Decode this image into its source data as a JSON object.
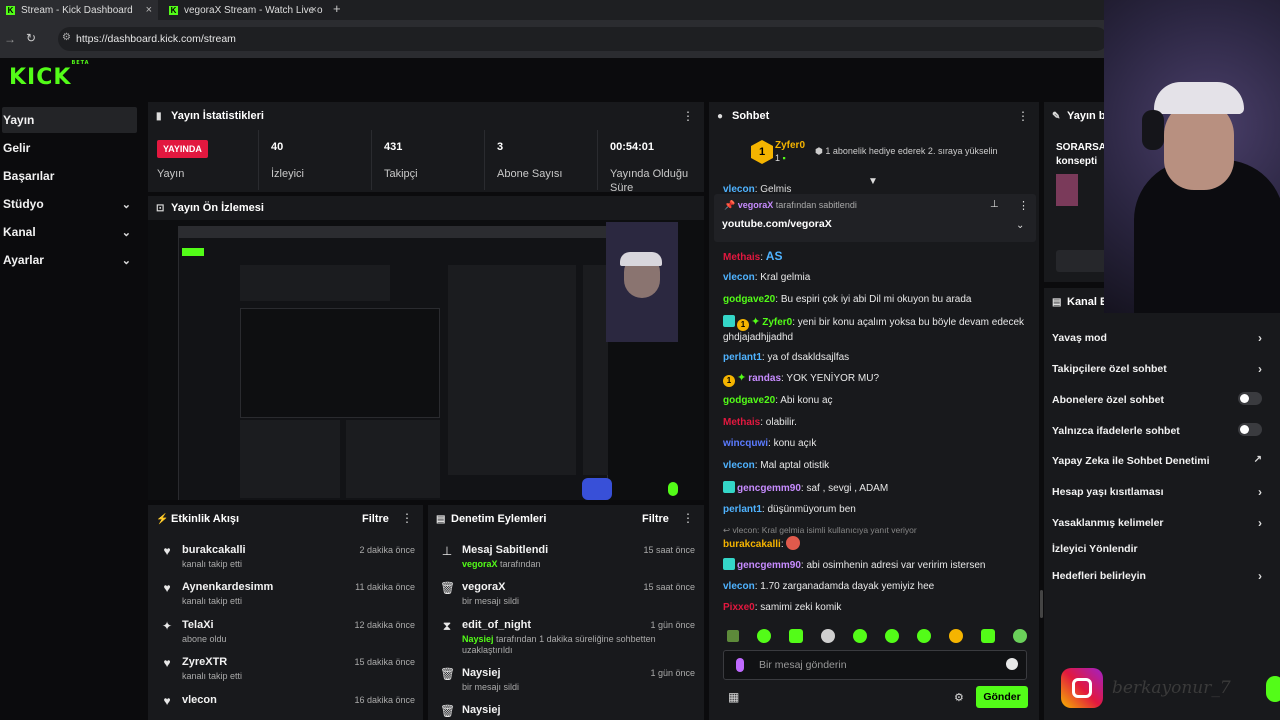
{
  "browser": {
    "tabs": [
      {
        "title": "Stream - Kick Dashboard"
      },
      {
        "title": "vegoraX Stream - Watch Live o"
      }
    ],
    "new_tab": "+",
    "url": "https://dashboard.kick.com/stream"
  },
  "logo": "KICK",
  "logo_sup": "BETA",
  "sidebar": {
    "items": [
      {
        "label": "Yayın"
      },
      {
        "label": "Gelir"
      },
      {
        "label": "Başarılar"
      },
      {
        "label": "Stüdyo"
      },
      {
        "label": "Kanal"
      },
      {
        "label": "Ayarlar"
      }
    ]
  },
  "stats": {
    "title": "Yayın İstatistikleri",
    "live_badge": "YAYINDA",
    "live_label": "Yayın",
    "viewers_value": "40",
    "viewers_label": "İzleyici",
    "followers_value": "431",
    "followers_label": "Takipçi",
    "subs_value": "3",
    "subs_label": "Abone Sayısı",
    "duration_value": "00:54:01",
    "duration_label": "Yayında Olduğu Süre"
  },
  "preview": {
    "title": "Yayın Ön İzlemesi"
  },
  "activity": {
    "title": "Etkinlik Akışı",
    "filter": "Filtre",
    "items": [
      {
        "name": "burakcakalli",
        "sub": "kanalı takip etti",
        "time": "2 dakika önce",
        "icon": "heart-icon"
      },
      {
        "name": "Aynenkardesimm",
        "sub": "kanalı takip etti",
        "time": "11 dakika önce",
        "icon": "heart-icon"
      },
      {
        "name": "TelaXi",
        "sub": "abone oldu",
        "time": "12 dakika önce",
        "icon": "sparkle-icon"
      },
      {
        "name": "ZyreXTR",
        "sub": "kanalı takip etti",
        "time": "15 dakika önce",
        "icon": "heart-icon"
      },
      {
        "name": "vlecon",
        "sub": "",
        "time": "16 dakika önce",
        "icon": "heart-icon"
      }
    ]
  },
  "moderation": {
    "title": "Denetim Eylemleri",
    "filter": "Filtre",
    "items": [
      {
        "name": "Mesaj Sabitlendi",
        "sub_user": "vegoraX",
        "sub_rest": " tarafından",
        "time": "15 saat önce",
        "icon": "pin-icon"
      },
      {
        "name": "vegoraX",
        "sub_user": "",
        "sub_rest": "bir mesajı sildi",
        "time": "15 saat önce",
        "icon": "trash-icon"
      },
      {
        "name": "edit_of_night",
        "sub_user": "Naysiej",
        "sub_rest": " tarafından 1 dakika süreliğine sohbetten uzaklaştırıldı",
        "time": "1 gün önce",
        "icon": "hourglass-icon"
      },
      {
        "name": "Naysiej",
        "sub_user": "",
        "sub_rest": "bir mesajı sildi",
        "time": "1 gün önce",
        "icon": "trash-icon"
      },
      {
        "name": "Naysiej",
        "sub_user": "",
        "sub_rest": "",
        "time": "",
        "icon": "trash-icon"
      }
    ]
  },
  "chat": {
    "title": "Sohbet",
    "top_user": "Zyfer0",
    "top_count": "1",
    "top_msg": "1 abonelik hediye ederek 2. sıraya yükselin",
    "partial_user": "vlecon",
    "partial_text": "Gelmis",
    "pinned_by": "vegoraX",
    "pinned_suffix": "tarafından sabitlendi",
    "pinned_text": "youtube.com/vegoraX",
    "messages": [
      {
        "user": "Methais",
        "text": "AS",
        "color": "#e2183f"
      },
      {
        "user": "vlecon",
        "text": "Kral gelmia",
        "color": "#4fb3ff"
      },
      {
        "user": "godgave20",
        "text": "Bu espiri çok iyi abi Dil mi okuyon bu arada",
        "color": "#53fc18"
      },
      {
        "user": "Zyfer0",
        "text": "yeni bir konu açalım yoksa bu böyle devam edecek ghdjajadhjjadhd",
        "color": "#53fc18"
      },
      {
        "user": "perlant1",
        "text": "ya of dsakldsajlfas",
        "color": "#4fb3ff"
      },
      {
        "user": "randas",
        "text": "YOK YENİYOR MU?",
        "color": "#c78cff"
      },
      {
        "user": "godgave20",
        "text": "Abi konu aç",
        "color": "#53fc18"
      },
      {
        "user": "Methais",
        "text": "olabilir.",
        "color": "#e2183f"
      },
      {
        "user": "wincquwi",
        "text": "konu açık",
        "color": "#5b7bff"
      },
      {
        "user": "vlecon",
        "text": "Mal aptal otistik",
        "color": "#4fb3ff"
      },
      {
        "user": "gencgemm90",
        "text": "saf , sevgi , ADAM",
        "color": "#c78cff"
      },
      {
        "user": "perlant1",
        "text": "düşünmüyorum ben",
        "color": "#4fb3ff"
      },
      {
        "user": "burakcakalli",
        "text": "",
        "color": "#f5b400"
      },
      {
        "user": "gencgemm90",
        "text": "abi osimhenin adresi var veririm istersen",
        "color": "#c78cff"
      },
      {
        "user": "vlecon",
        "text": "1.70 zarganadamda dayak yemiyiz hee",
        "color": "#4fb3ff"
      },
      {
        "user": "Pixxe0",
        "text": "samimi zeki komik",
        "color": "#e2183f"
      }
    ],
    "reply_to": "vlecon: Kral gelmia isimli kullanıcıya yanıt veriyor",
    "input_placeholder": "Bir mesaj gönderin",
    "send_label": "Gönder"
  },
  "settings": {
    "title_partial": "Yayın bi",
    "sorarsa": "SORARSA",
    "konsepti": "konsepti",
    "channel_title": "Kanal E",
    "rows": [
      {
        "label": "Yavaş mod",
        "control": "chevron"
      },
      {
        "label": "Takipçilere özel sohbet",
        "control": "chevron"
      },
      {
        "label": "Abonelere özel sohbet",
        "control": "toggle"
      },
      {
        "label": "Yalnızca ifadelerle sohbet",
        "control": "toggle"
      },
      {
        "label": "Yapay Zeka ile Sohbet Denetimi",
        "control": "external"
      },
      {
        "label": "Hesap yaşı kısıtlaması",
        "control": "chevron"
      },
      {
        "label": "Yasaklanmış kelimeler",
        "control": "chevron"
      },
      {
        "label": "İzleyici Yönlendir",
        "control": "none"
      },
      {
        "label": "Hedefleri belirleyin",
        "control": "chevron"
      }
    ]
  },
  "watermark": "berkayonur_7",
  "colors": {
    "accent": "#53fc18",
    "live": "#e2183f",
    "panel": "#18191c"
  }
}
